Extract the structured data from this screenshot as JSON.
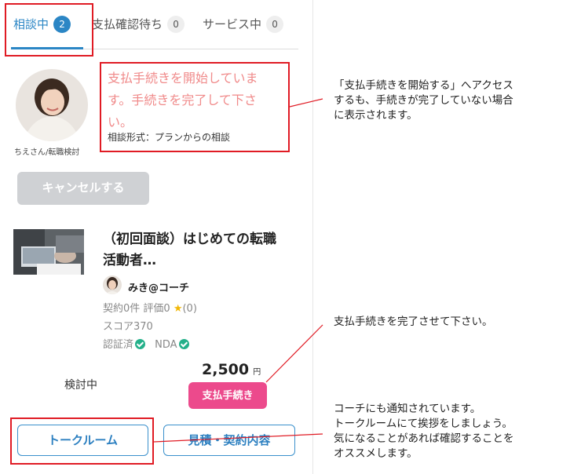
{
  "tabs": [
    {
      "label": "相談中",
      "count": "2"
    },
    {
      "label": "支払確認待ち",
      "count": "0"
    },
    {
      "label": "サービス中",
      "count": "0"
    }
  ],
  "request": {
    "status_line1": "支払手続きを開始していま",
    "status_line2": "す。手続きを完了して下さ",
    "status_line3": "い。",
    "consult_type": "相談形式：プランからの相談",
    "user_caption": "ちえさん/転職検討",
    "cancel_label": "キャンセルする"
  },
  "plan": {
    "title_line1": "（初回面談）はじめての転職",
    "title_line2": "活動者…",
    "coach_name": "みき@コーチ",
    "contracts": "契約0件 評価0",
    "rating_star": "★",
    "rating_count": "(0)",
    "score": "スコア370",
    "verified": "認証済",
    "nda": "NDA",
    "status": "検討中",
    "price": "2,500",
    "price_unit": "円",
    "pay_label": "支払手続き"
  },
  "buttons": {
    "talk_room": "トークルーム",
    "estimate": "見積・契約内容"
  },
  "notes": {
    "note1_line1": "「支払手続きを開始する」へアクセス",
    "note1_line2": "するも、手続きが完了していない場合",
    "note1_line3": "に表示されます。",
    "note2": "支払手続きを完了させて下さい。",
    "note3_line1": "コーチにも通知されています。",
    "note3_line2": "トークルームにて挨拶をしましょう。",
    "note3_line3": "気になることがあれば確認することを",
    "note3_line4": "オススメします。"
  },
  "colors": {
    "accent_blue": "#2b86c5",
    "annotation_red": "#e01b24",
    "pay_pink": "#ec4a8c",
    "status_pink": "#f08a8a",
    "verified_green": "#24b08a"
  }
}
